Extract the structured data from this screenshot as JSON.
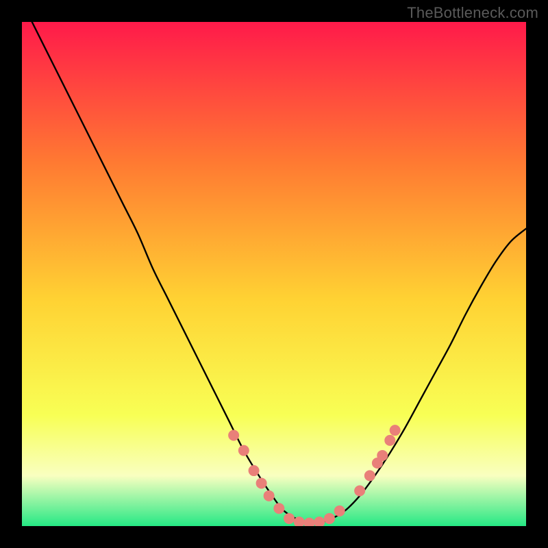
{
  "watermark": "TheBottleneck.com",
  "colors": {
    "frame": "#000000",
    "grad_top": "#ff1a4a",
    "grad_mid_upper": "#ff7a32",
    "grad_mid": "#ffd233",
    "grad_mid_lower": "#f8ff55",
    "grad_band_light": "#f9ffc0",
    "grad_bottom": "#25e884",
    "curve": "#000000",
    "marker": "#e98079",
    "marker_stroke": "#e98079"
  },
  "chart_data": {
    "type": "line",
    "title": "",
    "xlabel": "",
    "ylabel": "",
    "xlim": [
      0,
      100
    ],
    "ylim": [
      0,
      100
    ],
    "series": [
      {
        "name": "bottleneck-curve",
        "x": [
          2,
          5,
          8,
          11,
          14,
          17,
          20,
          23,
          26,
          29,
          32,
          35,
          38,
          41,
          44,
          47,
          50,
          52,
          55,
          58,
          61,
          64,
          67,
          70,
          73,
          76,
          79,
          82,
          85,
          88,
          91,
          94,
          97,
          100
        ],
        "y": [
          100,
          94,
          88,
          82,
          76,
          70,
          64,
          58,
          51,
          45,
          39,
          33,
          27,
          21,
          15,
          10,
          5.5,
          3,
          1.2,
          0.5,
          1.3,
          3.0,
          6.0,
          10.0,
          14.5,
          19.5,
          25.0,
          30.5,
          36.0,
          42.0,
          47.5,
          52.5,
          56.5,
          59.0
        ]
      }
    ],
    "markers": {
      "name": "sample-points",
      "points": [
        {
          "x": 42,
          "y": 18
        },
        {
          "x": 44,
          "y": 15
        },
        {
          "x": 46,
          "y": 11
        },
        {
          "x": 47.5,
          "y": 8.5
        },
        {
          "x": 49,
          "y": 6
        },
        {
          "x": 51,
          "y": 3.5
        },
        {
          "x": 53,
          "y": 1.5
        },
        {
          "x": 55,
          "y": 0.8
        },
        {
          "x": 57,
          "y": 0.6
        },
        {
          "x": 59,
          "y": 0.8
        },
        {
          "x": 61,
          "y": 1.5
        },
        {
          "x": 63,
          "y": 3
        },
        {
          "x": 67,
          "y": 7
        },
        {
          "x": 69,
          "y": 10
        },
        {
          "x": 70.5,
          "y": 12.5
        },
        {
          "x": 71.5,
          "y": 14
        },
        {
          "x": 73,
          "y": 17
        },
        {
          "x": 74,
          "y": 19
        }
      ]
    }
  }
}
